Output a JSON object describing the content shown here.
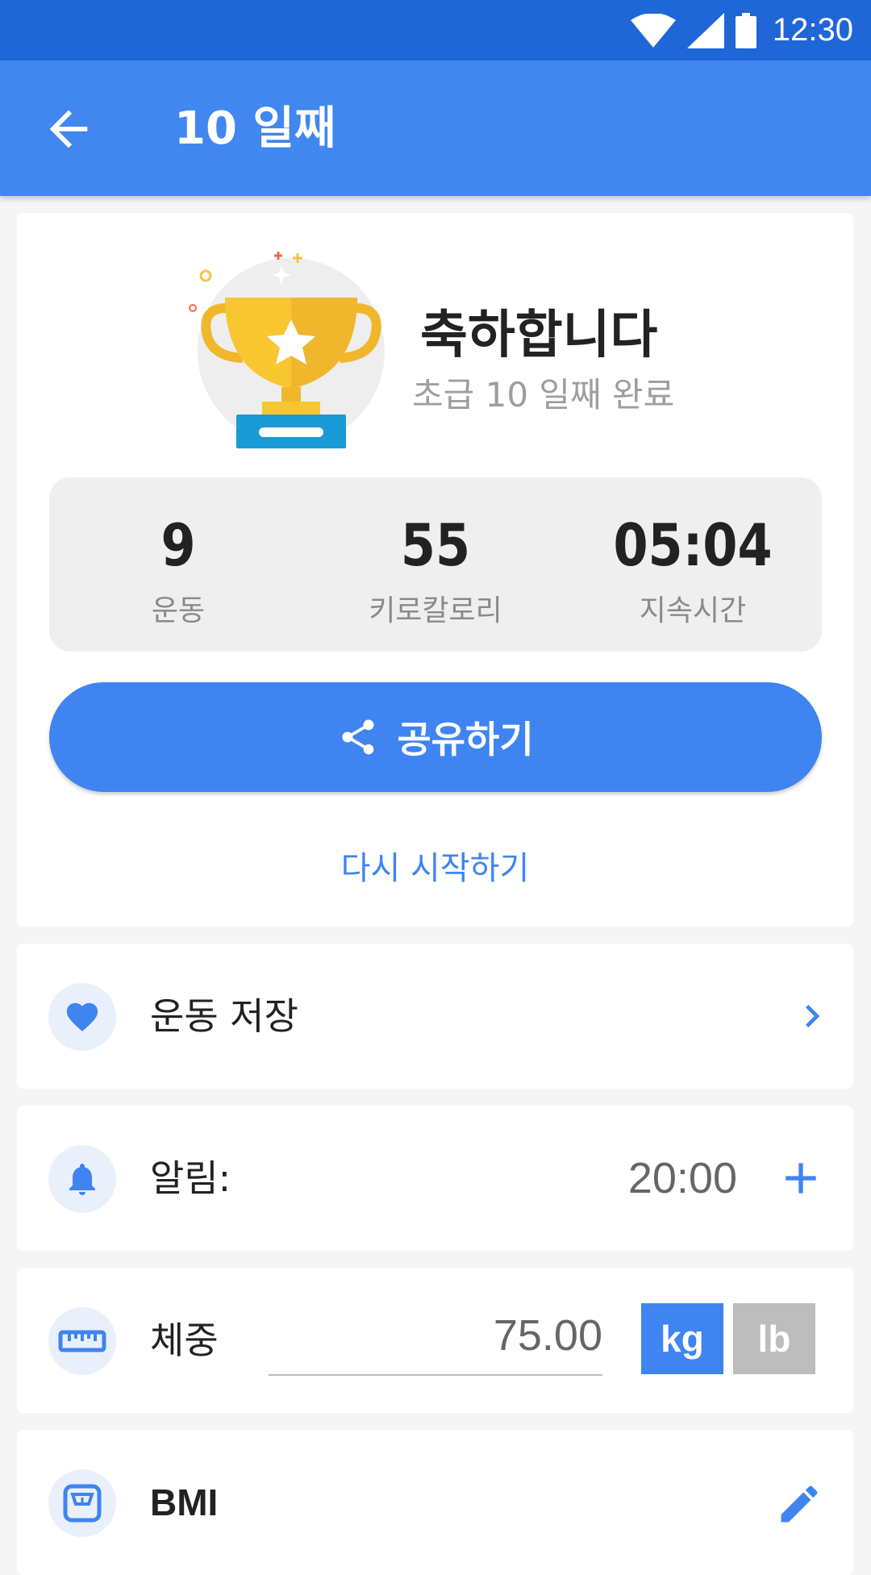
{
  "status_bar": {
    "time": "12:30",
    "icons": [
      "wifi-icon",
      "cell-signal-icon",
      "battery-icon"
    ]
  },
  "app_bar": {
    "title": "10 일째",
    "back_icon": "arrow-back-icon"
  },
  "summary": {
    "title": "축하합니다",
    "subtitle": "초급 10 일째 완료",
    "stats": [
      {
        "value": "9",
        "label": "운동"
      },
      {
        "value": "55",
        "label": "키로칼로리"
      },
      {
        "value": "05:04",
        "label": "지속시간"
      }
    ],
    "share_label": "공유하기",
    "restart_label": "다시 시작하기"
  },
  "save_row": {
    "label": "운동 저장",
    "icon": "heart-icon",
    "action_icon": "chevron-right-icon"
  },
  "alarm_row": {
    "label": "알림:",
    "time": "20:00",
    "icon": "bell-icon",
    "action_icon": "plus-icon"
  },
  "weight_row": {
    "label": "체중",
    "value": "75.00",
    "unit_kg": "kg",
    "unit_lb": "lb",
    "selected_unit": "kg",
    "icon": "ruler-icon"
  },
  "bmi_row": {
    "label": "BMI",
    "icon": "scale-icon",
    "action_icon": "pencil-icon"
  },
  "colors": {
    "primary": "#4286f0",
    "status_bar": "#1f66d6",
    "accent": "#3f84f1",
    "trophy_gold": "#f8c630"
  }
}
